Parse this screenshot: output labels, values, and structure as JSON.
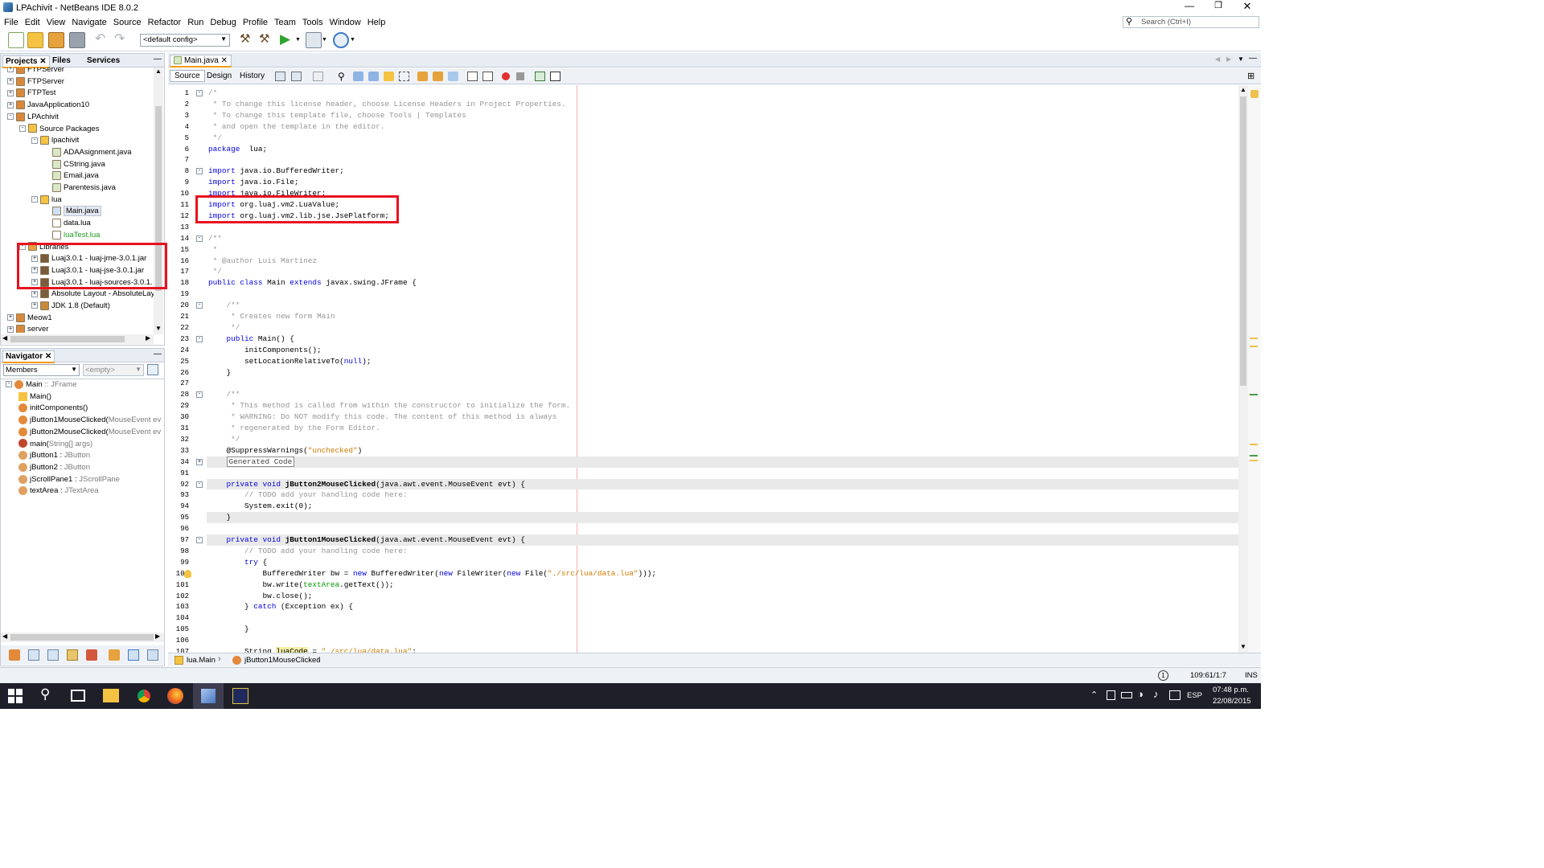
{
  "window": {
    "title": "LPAchivit - NetBeans IDE 8.0.2"
  },
  "menu": [
    "File",
    "Edit",
    "View",
    "Navigate",
    "Source",
    "Refactor",
    "Run",
    "Debug",
    "Profile",
    "Team",
    "Tools",
    "Window",
    "Help"
  ],
  "search": {
    "placeholder": "Search (Ctrl+I)"
  },
  "toolbar": {
    "config": "<default config>"
  },
  "projects_panel": {
    "tabs": [
      "Projects",
      "Files",
      "Services"
    ],
    "tree": [
      {
        "label": "FTPServer",
        "depth": 0,
        "icon": "project-icon",
        "expander": "+"
      },
      {
        "label": "FTPServer",
        "depth": 0,
        "icon": "project-icon",
        "expander": "+"
      },
      {
        "label": "FTPTest",
        "depth": 0,
        "icon": "project-icon",
        "expander": "+"
      },
      {
        "label": "JavaApplication10",
        "depth": 0,
        "icon": "project-icon",
        "expander": "+"
      },
      {
        "label": "LPAchivit",
        "depth": 0,
        "icon": "project-icon",
        "expander": "-"
      },
      {
        "label": "Source Packages",
        "depth": 1,
        "icon": "source-packages-icon",
        "expander": "-"
      },
      {
        "label": "lpachivit",
        "depth": 2,
        "icon": "package-icon",
        "expander": "-"
      },
      {
        "label": "ADAAsignment.java",
        "depth": 3,
        "icon": "java-file-icon",
        "expander": ""
      },
      {
        "label": "CString.java",
        "depth": 3,
        "icon": "java-file-icon",
        "expander": ""
      },
      {
        "label": "Email.java",
        "depth": 3,
        "icon": "java-file-icon",
        "expander": ""
      },
      {
        "label": "Parentesis.java",
        "depth": 3,
        "icon": "java-file-icon",
        "expander": ""
      },
      {
        "label": "lua",
        "depth": 2,
        "icon": "package-icon",
        "expander": "-"
      },
      {
        "label": "Main.java",
        "depth": 3,
        "icon": "java-form-icon",
        "expander": "",
        "selected": true
      },
      {
        "label": "data.lua",
        "depth": 3,
        "icon": "file-icon",
        "expander": ""
      },
      {
        "label": "luaTest.lua",
        "depth": 3,
        "icon": "file-icon",
        "expander": "",
        "green": true
      },
      {
        "label": "Libraries",
        "depth": 1,
        "icon": "libraries-icon",
        "expander": "-"
      },
      {
        "label": "Luaj3.0.1 - luaj-jme-3.0.1.jar",
        "depth": 2,
        "icon": "jar-icon",
        "expander": "+"
      },
      {
        "label": "Luaj3.0.1 - luaj-jse-3.0.1.jar",
        "depth": 2,
        "icon": "jar-icon",
        "expander": "+"
      },
      {
        "label": "Luaj3.0.1 - luaj-sources-3.0.1.",
        "depth": 2,
        "icon": "jar-icon",
        "expander": "+"
      },
      {
        "label": "Absolute Layout - AbsoluteLay",
        "depth": 2,
        "icon": "jar-icon",
        "expander": "+"
      },
      {
        "label": "JDK 1.8 (Default)",
        "depth": 2,
        "icon": "jdk-icon",
        "expander": "+"
      },
      {
        "label": "Meow1",
        "depth": 0,
        "icon": "project-icon",
        "expander": "+"
      },
      {
        "label": "server",
        "depth": 0,
        "icon": "project-icon",
        "expander": "+"
      }
    ]
  },
  "navigator": {
    "title": "Navigator",
    "filter": "Members",
    "empty": "<empty>",
    "items": [
      {
        "name": "Main",
        "type": " :: JFrame",
        "depth": 0,
        "icon": "class-icon"
      },
      {
        "name": "Main()",
        "type": "",
        "depth": 1,
        "icon": "constructor-icon"
      },
      {
        "name": "initComponents()",
        "type": "",
        "depth": 1,
        "icon": "method-icon"
      },
      {
        "name": "jButton1MouseClicked(",
        "type": "MouseEvent ev",
        "depth": 1,
        "icon": "method-icon"
      },
      {
        "name": "jButton2MouseClicked(",
        "type": "MouseEvent ev",
        "depth": 1,
        "icon": "method-icon"
      },
      {
        "name": "main(",
        "type": "String[] args)",
        "depth": 1,
        "icon": "static-method-icon"
      },
      {
        "name": "jButton1 : ",
        "type": "JButton",
        "depth": 1,
        "icon": "field-icon"
      },
      {
        "name": "jButton2 : ",
        "type": "JButton",
        "depth": 1,
        "icon": "field-icon"
      },
      {
        "name": "jScrollPane1 : ",
        "type": "JScrollPane",
        "depth": 1,
        "icon": "field-icon"
      },
      {
        "name": "textArea : ",
        "type": "JTextArea",
        "depth": 1,
        "icon": "field-icon"
      }
    ]
  },
  "editor": {
    "tab": "Main.java",
    "modes": [
      "Source",
      "Design",
      "History"
    ],
    "lines": [
      {
        "n": "1",
        "fold": "-",
        "t": [
          [
            "cm",
            "/*"
          ]
        ]
      },
      {
        "n": "2",
        "t": [
          [
            "cm",
            " * To change this license header, choose License Headers in Project Properties."
          ]
        ]
      },
      {
        "n": "3",
        "t": [
          [
            "cm",
            " * To change this template file, choose Tools | Templates"
          ]
        ]
      },
      {
        "n": "4",
        "t": [
          [
            "cm",
            " * and open the template in the editor."
          ]
        ]
      },
      {
        "n": "5",
        "t": [
          [
            "cm",
            " */"
          ]
        ]
      },
      {
        "n": "6",
        "t": [
          [
            "kw",
            "package"
          ],
          [
            "",
            "  lua;"
          ]
        ]
      },
      {
        "n": "7",
        "t": []
      },
      {
        "n": "8",
        "fold": "-",
        "t": [
          [
            "kw",
            "import"
          ],
          [
            "",
            " java.io.BufferedWriter;"
          ]
        ]
      },
      {
        "n": "9",
        "t": [
          [
            "kw",
            "import"
          ],
          [
            "",
            " java.io.File;"
          ]
        ]
      },
      {
        "n": "10",
        "t": [
          [
            "kw",
            "import"
          ],
          [
            "",
            " java.io.FileWriter;"
          ]
        ]
      },
      {
        "n": "11",
        "t": [
          [
            "kw",
            "import"
          ],
          [
            "",
            " org.luaj.vm2.LuaValue;"
          ]
        ]
      },
      {
        "n": "12",
        "t": [
          [
            "kw",
            "import"
          ],
          [
            "",
            " org.luaj.vm2.lib.jse.JsePlatform;"
          ]
        ]
      },
      {
        "n": "13",
        "t": []
      },
      {
        "n": "14",
        "fold": "-",
        "t": [
          [
            "cm",
            "/**"
          ]
        ]
      },
      {
        "n": "15",
        "t": [
          [
            "cm",
            " *"
          ]
        ]
      },
      {
        "n": "16",
        "t": [
          [
            "cm",
            " * @author Luis Martinez"
          ]
        ]
      },
      {
        "n": "17",
        "t": [
          [
            "cm",
            " */"
          ]
        ]
      },
      {
        "n": "18",
        "t": [
          [
            "kw",
            "public class"
          ],
          [
            "",
            " Main "
          ],
          [
            "kw",
            "extends"
          ],
          [
            "",
            " javax.swing.JFrame {"
          ]
        ]
      },
      {
        "n": "19",
        "t": []
      },
      {
        "n": "20",
        "fold": "-",
        "t": [
          [
            "cm",
            "    /**"
          ]
        ]
      },
      {
        "n": "21",
        "t": [
          [
            "cm",
            "     * Creates new form Main"
          ]
        ]
      },
      {
        "n": "22",
        "t": [
          [
            "cm",
            "     */"
          ]
        ]
      },
      {
        "n": "23",
        "fold": "-",
        "t": [
          [
            "kw",
            "    public"
          ],
          [
            "",
            " Main() {"
          ]
        ]
      },
      {
        "n": "24",
        "t": [
          [
            "",
            "        initComponents();"
          ]
        ]
      },
      {
        "n": "25",
        "t": [
          [
            "",
            "        setLocationRelativeTo("
          ],
          [
            "kw",
            "null"
          ],
          [
            "",
            ");"
          ]
        ]
      },
      {
        "n": "26",
        "t": [
          [
            "",
            "    }"
          ]
        ]
      },
      {
        "n": "27",
        "t": []
      },
      {
        "n": "28",
        "fold": "-",
        "t": [
          [
            "cm",
            "    /**"
          ]
        ]
      },
      {
        "n": "29",
        "t": [
          [
            "cm",
            "     * This method is called from within the constructor to initialize the form."
          ]
        ]
      },
      {
        "n": "30",
        "t": [
          [
            "cm",
            "     * WARNING: Do NOT modify this code. The content of this method is always"
          ]
        ]
      },
      {
        "n": "31",
        "t": [
          [
            "cm",
            "     * regenerated by the Form Editor."
          ]
        ]
      },
      {
        "n": "32",
        "t": [
          [
            "cm",
            "     */"
          ]
        ]
      },
      {
        "n": "33",
        "t": [
          [
            "",
            "    @SuppressWarnings("
          ],
          [
            "str",
            "\"unchecked\""
          ],
          [
            "",
            ")"
          ]
        ]
      },
      {
        "n": "34",
        "fold": "+",
        "hl": true,
        "t": [
          [
            "",
            "    "
          ],
          [
            "box",
            "Generated Code"
          ]
        ]
      },
      {
        "n": "91",
        "t": []
      },
      {
        "n": "92",
        "fold": "-",
        "hl": true,
        "t": [
          [
            "kw",
            "    private void"
          ],
          [
            "",
            " "
          ],
          [
            "bold",
            "jButton2MouseClicked"
          ],
          [
            "",
            "(java.awt.event.MouseEvent evt) {"
          ]
        ]
      },
      {
        "n": "93",
        "t": [
          [
            "cm",
            "        // TODO add your handling code here:"
          ]
        ]
      },
      {
        "n": "94",
        "t": [
          [
            "",
            "        System.exit(0);"
          ]
        ]
      },
      {
        "n": "95",
        "hl": true,
        "t": [
          [
            "",
            "    }"
          ]
        ]
      },
      {
        "n": "96",
        "t": []
      },
      {
        "n": "97",
        "fold": "-",
        "hl": true,
        "t": [
          [
            "kw",
            "    private void"
          ],
          [
            "",
            " "
          ],
          [
            "bold",
            "jButton1MouseClicked"
          ],
          [
            "",
            "(java.awt.event.MouseEvent evt) {"
          ]
        ]
      },
      {
        "n": "98",
        "t": [
          [
            "cm",
            "        // TODO add your handling code here:"
          ]
        ]
      },
      {
        "n": "99",
        "t": [
          [
            "kw",
            "        try"
          ],
          [
            "",
            " {"
          ]
        ]
      },
      {
        "n": "100",
        "bulb": true,
        "t": [
          [
            "",
            "            BufferedWriter bw = "
          ],
          [
            "kw",
            "new"
          ],
          [
            "",
            " BufferedWriter("
          ],
          [
            "kw",
            "new"
          ],
          [
            "",
            " FileWriter("
          ],
          [
            "kw",
            "new"
          ],
          [
            "",
            " File("
          ],
          [
            "str",
            "\"./src/lua/data.lua\""
          ],
          [
            "",
            ")));"
          ]
        ]
      },
      {
        "n": "101",
        "t": [
          [
            "",
            "            bw.write("
          ],
          [
            "fld",
            "textArea"
          ],
          [
            "",
            ".getText());"
          ]
        ]
      },
      {
        "n": "102",
        "t": [
          [
            "",
            "            bw.close();"
          ]
        ]
      },
      {
        "n": "103",
        "t": [
          [
            "",
            "        } "
          ],
          [
            "kw",
            "catch"
          ],
          [
            "",
            " (Exception ex) {"
          ]
        ]
      },
      {
        "n": "104",
        "t": []
      },
      {
        "n": "105",
        "t": [
          [
            "",
            "        }"
          ]
        ]
      },
      {
        "n": "106",
        "t": []
      },
      {
        "n": "107",
        "t": [
          [
            "",
            "        String "
          ],
          [
            "var",
            "luaCode"
          ],
          [
            "",
            " = "
          ],
          [
            "str",
            "\"./src/lua/data.lua\""
          ],
          [
            "",
            ";"
          ]
        ]
      }
    ]
  },
  "breadcrumbs": [
    "lua.Main",
    "jButton1MouseClicked"
  ],
  "status": {
    "position": "109:61/1:7",
    "mode": "INS"
  },
  "taskbar": {
    "lang": "ESP",
    "time": "07:48 p.m.",
    "date": "22/08/2015"
  },
  "colors": {
    "keyword": "#0000e6",
    "comment": "#969696",
    "string": "#ce7b00",
    "field": "#009900",
    "highlight": "#e9e9e9",
    "redbox": "#e8121f"
  }
}
